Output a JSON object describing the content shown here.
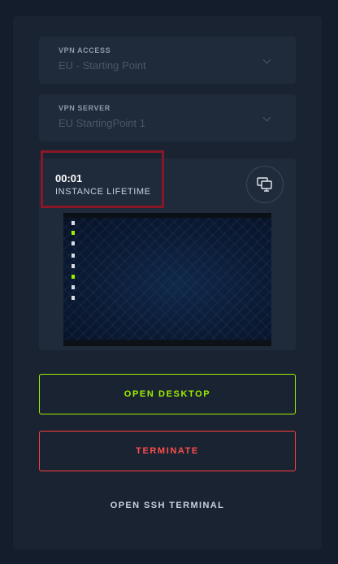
{
  "vpn_access": {
    "label": "VPN ACCESS",
    "value": "EU - Starting Point",
    "icon": "chevron-down-icon"
  },
  "vpn_server": {
    "label": "VPN SERVER",
    "value": "EU StartingPoint 1",
    "icon": "chevron-down-icon"
  },
  "instance": {
    "timer": "00:01",
    "lifetime_label": "INSTANCE LIFETIME",
    "desktop_icon": "monitor-icon"
  },
  "actions": {
    "open_desktop": "OPEN DESKTOP",
    "terminate": "TERMINATE",
    "open_ssh": "OPEN SSH TERMINAL"
  },
  "colors": {
    "accent_green": "#9fef00",
    "danger_red": "#ff3e3e",
    "highlight": "#8a1728",
    "panel": "#1a2332",
    "background": "#141d2b"
  }
}
